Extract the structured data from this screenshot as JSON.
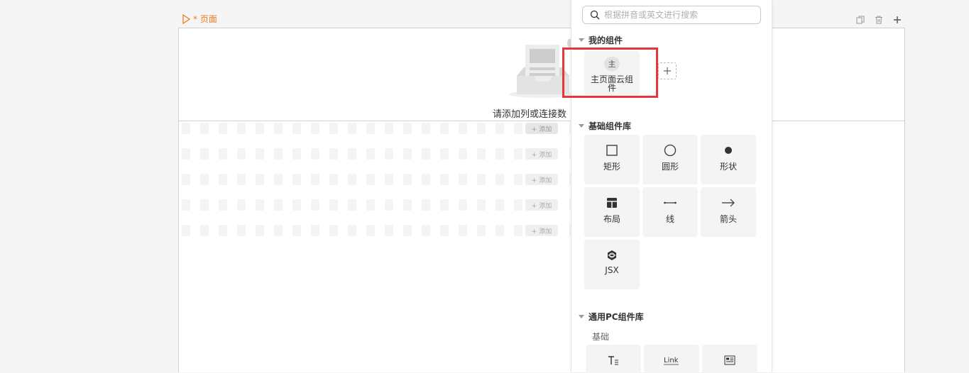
{
  "page_label": "* 页面",
  "empty_text": "请添加列或连接数",
  "add_chip_label": "+ 添加",
  "search": {
    "placeholder": "根据拼音或英文进行搜索",
    "value": ""
  },
  "my_components": {
    "title": "我的组件",
    "items": [
      {
        "badge": "主",
        "label": "主页面云组件"
      }
    ]
  },
  "basic_library": {
    "title": "基础组件库",
    "items": [
      {
        "label": "矩形",
        "icon": "square-icon"
      },
      {
        "label": "圆形",
        "icon": "circle-icon"
      },
      {
        "label": "形状",
        "icon": "dot-icon"
      },
      {
        "label": "布局",
        "icon": "layout-icon"
      },
      {
        "label": "线",
        "icon": "line-icon"
      },
      {
        "label": "箭头",
        "icon": "arrow-icon"
      },
      {
        "label": "JSX",
        "icon": "jsx-icon"
      }
    ]
  },
  "pc_library": {
    "title": "通用PC组件库",
    "subsection": "基础",
    "items": [
      {
        "label": "Tt",
        "icon": "text-icon"
      },
      {
        "label": "Link",
        "icon": "link-icon"
      },
      {
        "label": "",
        "icon": "richtext-icon"
      }
    ]
  },
  "colors": {
    "accent": "#f07c1e",
    "highlight": "#e8353b"
  }
}
